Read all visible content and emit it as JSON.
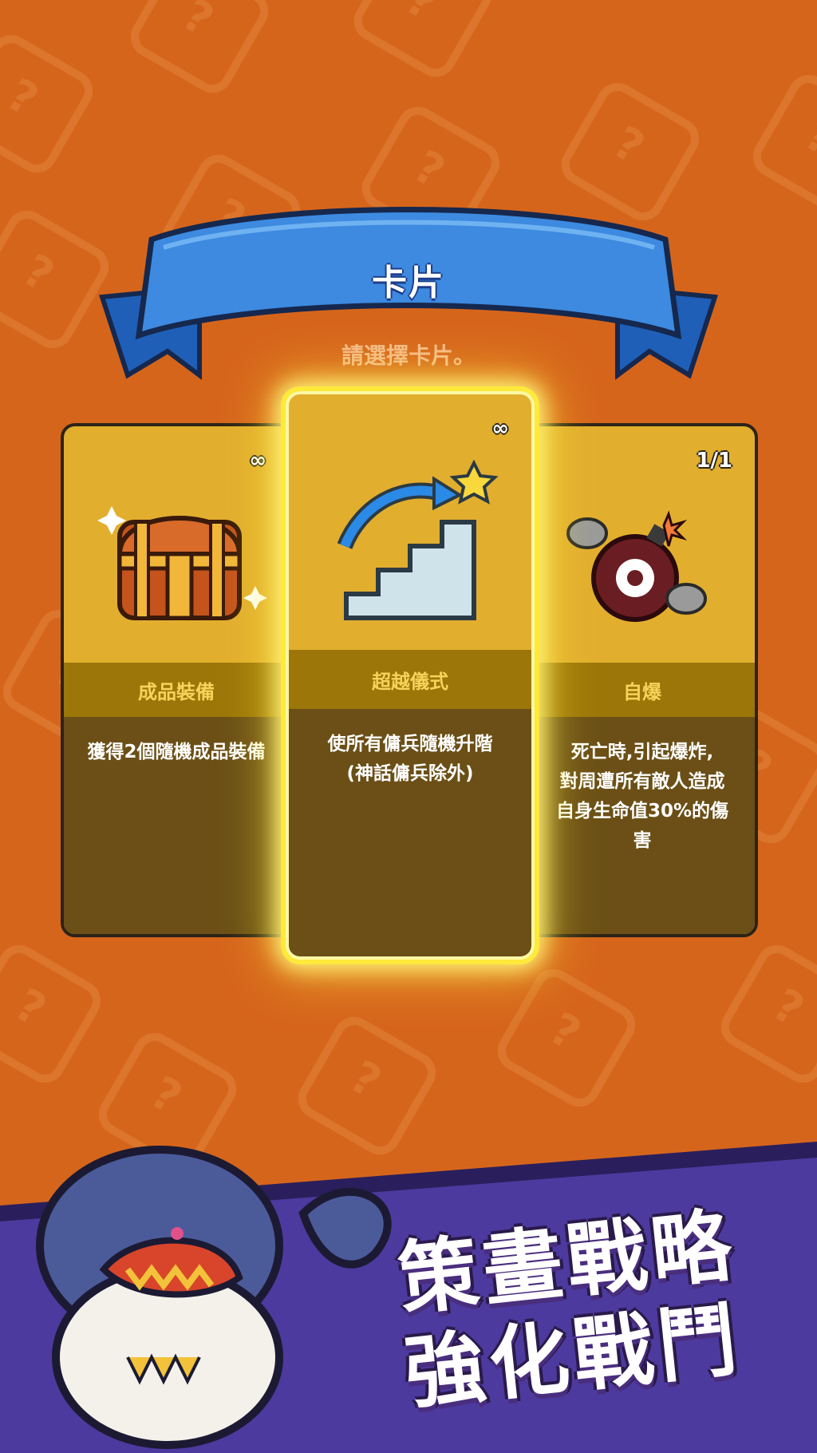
{
  "banner": {
    "title": "卡片"
  },
  "subtitle": "請選擇卡片。",
  "cards": [
    {
      "count": "∞",
      "name": "成品裝備",
      "description": "獲得2個隨機成品裝備",
      "icon": "treasure-chest-icon"
    },
    {
      "count": "∞",
      "name": "超越儀式",
      "description": "使所有傭兵隨機升階\n(神話傭兵除外)",
      "icon": "stairs-upgrade-icon",
      "selected": true
    },
    {
      "count": "1/1",
      "name": "自爆",
      "description": "死亡時,引起爆炸,\n對周遭所有敵人造成\n自身生命值30%的傷\n害",
      "icon": "bomb-skull-icon"
    }
  ],
  "promo": {
    "line1": "策畫戰略",
    "line2": "強化戰鬥"
  },
  "colors": {
    "background": "#d6651c",
    "banner": "#3d8ae0",
    "card": "#e2ae2e",
    "card_desc": "#6b4f16",
    "highlight": "#ffe93a",
    "promo_band": "#4c3a9e"
  }
}
